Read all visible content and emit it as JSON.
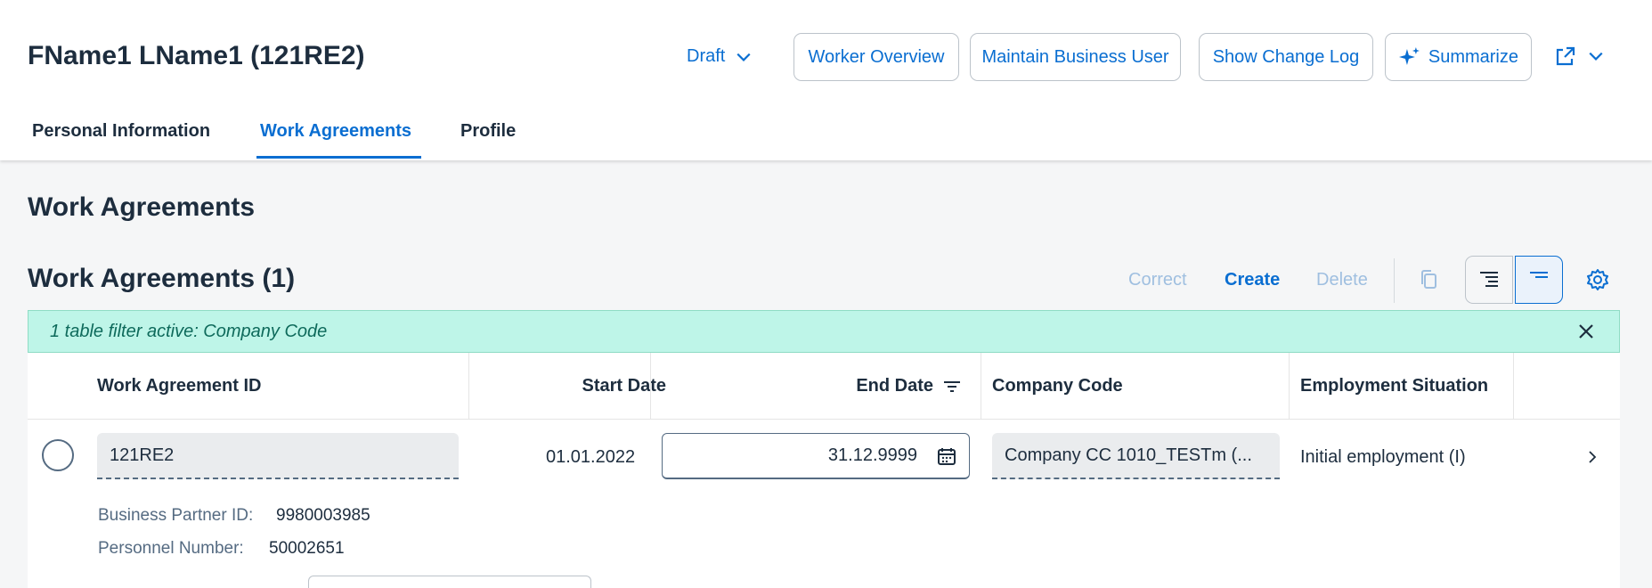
{
  "header": {
    "title": "FName1 LName1 (121RE2)",
    "draft_label": "Draft",
    "buttons": {
      "worker_overview": "Worker Overview",
      "maintain_business_user": "Maintain Business User",
      "show_change_log": "Show Change Log",
      "summarize": "Summarize"
    },
    "share_icon": "share-icon"
  },
  "tabs": [
    {
      "label": "Personal Information"
    },
    {
      "label": "Work Agreements",
      "active": true
    },
    {
      "label": "Profile"
    }
  ],
  "section": {
    "title": "Work Agreements"
  },
  "table": {
    "title": "Work Agreements (1)",
    "toolbar": {
      "correct": "Correct",
      "create": "Create",
      "delete": "Delete"
    },
    "filter_text": "1 table filter active: Company Code",
    "columns": [
      "Work Agreement ID",
      "Start Date",
      "End Date",
      "Company Code",
      "Employment Situation"
    ],
    "rows": [
      {
        "work_agreement_id": "121RE2",
        "start_date": "01.01.2022",
        "end_date": "31.12.9999",
        "company_code": "Company CC 1010_TESTm (...",
        "employment_situation": "Initial employment (I)",
        "details": {
          "bp_label": "Business Partner ID:",
          "bp_value": "9980003985",
          "personnel_label": "Personnel Number:",
          "personnel_value": "50002651"
        }
      }
    ]
  },
  "colors": {
    "accent": "#0a6ed1",
    "text": "#1d2d3e",
    "filter_bg": "#bef5e8",
    "disabled": "#9fbfe0"
  }
}
